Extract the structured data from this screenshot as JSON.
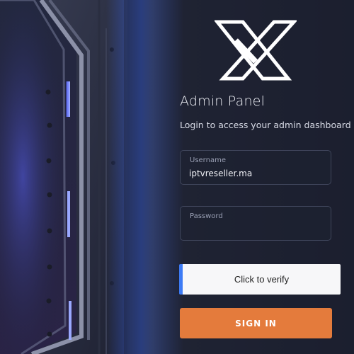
{
  "login": {
    "title": "Admin Panel",
    "subtitle": "Login to access your admin dashboard",
    "username": {
      "label": "Username",
      "value": "iptvreseller.ma"
    },
    "password": {
      "label": "Password",
      "value": ""
    },
    "captcha_label": "Click to verify",
    "submit_label": "SIGN IN"
  },
  "icons": {
    "logo": "x-logo-icon"
  },
  "colors": {
    "background": "#1b1f2e",
    "accent_glow": "#3d6cff",
    "submit_button": "#e47b3c",
    "captcha_bar": "#3d7bf5",
    "text_primary": "#eef0f6",
    "field_border": "#3f455b"
  }
}
